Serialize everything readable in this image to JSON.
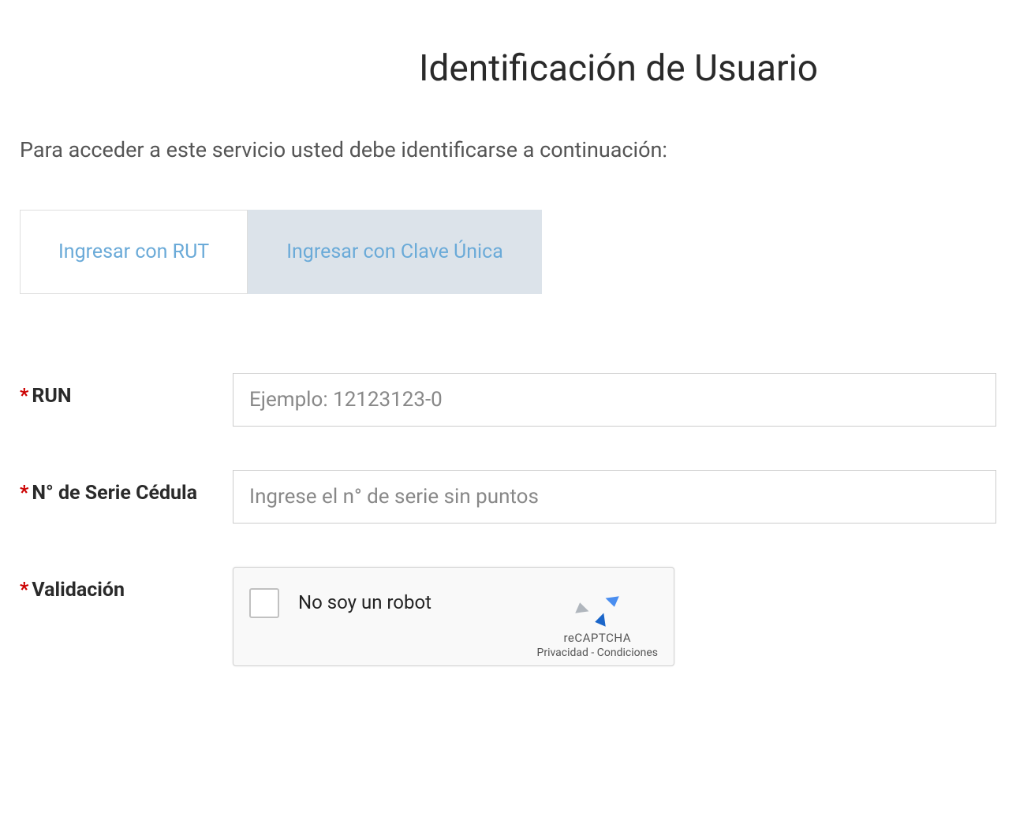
{
  "header": {
    "title": "Identificación de Usuario"
  },
  "intro": "Para acceder a este servicio usted debe identificarse a continuación:",
  "tabs": [
    {
      "label": "Ingresar con RUT",
      "active": true
    },
    {
      "label": "Ingresar con Clave Única",
      "active": false
    }
  ],
  "form": {
    "run": {
      "label": "RUN",
      "placeholder": "Ejemplo: 12123123-0",
      "value": ""
    },
    "serie": {
      "label": "N° de Serie Cédula",
      "placeholder": "Ingrese el n° de serie sin puntos",
      "value": ""
    },
    "validacion": {
      "label": "Validación"
    }
  },
  "recaptcha": {
    "text": "No soy un robot",
    "brand": "reCAPTCHA",
    "privacy": "Privacidad",
    "separator": " - ",
    "terms": "Condiciones"
  },
  "required_marker": "*"
}
